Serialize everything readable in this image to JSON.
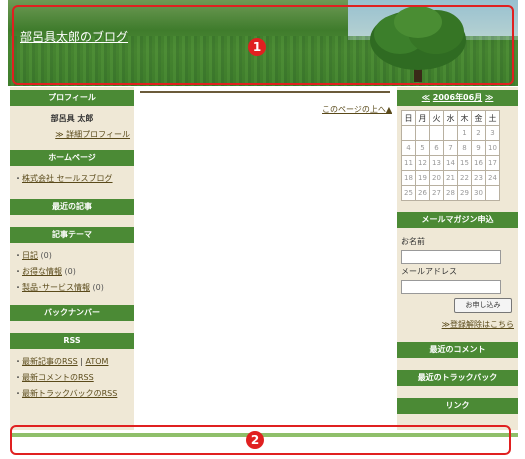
{
  "header": {
    "blog_title": "部呂具太郎のブログ"
  },
  "annotations": [
    "1",
    "2"
  ],
  "left": {
    "profile": {
      "heading": "プロフィール",
      "name": "部呂具 太郎",
      "detail_link": "≫ 詳細プロフィール"
    },
    "homepage": {
      "heading": "ホームページ",
      "link": "株式会社 セールスブログ"
    },
    "recent_posts": {
      "heading": "最近の記事"
    },
    "themes": {
      "heading": "記事テーマ",
      "items": [
        {
          "label": "日記",
          "count": "(0)"
        },
        {
          "label": "お得な情報",
          "count": "(0)"
        },
        {
          "label": "製品･サービス情報",
          "count": "(0)"
        }
      ]
    },
    "backnumber": {
      "heading": "バックナンバー"
    },
    "rss": {
      "heading": "RSS",
      "items": [
        "最新記事のRSS",
        "ATOM",
        "最新コメントのRSS",
        "最新トラックバックのRSS"
      ],
      "separator": "|"
    }
  },
  "center": {
    "page_top_link": "このページの上へ▲"
  },
  "right": {
    "calendar": {
      "prev": "≪",
      "title": "2006年06月",
      "next": "≫",
      "days_of_week": [
        "日",
        "月",
        "火",
        "水",
        "木",
        "金",
        "土"
      ],
      "weeks": [
        [
          "",
          "",
          "",
          "",
          "1",
          "2",
          "3"
        ],
        [
          "4",
          "5",
          "6",
          "7",
          "8",
          "9",
          "10"
        ],
        [
          "11",
          "12",
          "13",
          "14",
          "15",
          "16",
          "17"
        ],
        [
          "18",
          "19",
          "20",
          "21",
          "22",
          "23",
          "24"
        ],
        [
          "25",
          "26",
          "27",
          "28",
          "29",
          "30",
          ""
        ]
      ]
    },
    "magazine": {
      "heading": "メールマガジン申込",
      "name_label": "お名前",
      "email_label": "メールアドレス",
      "submit": "お申し込み",
      "unsubscribe_link": "≫登録解除はこちら"
    },
    "recent_comments": {
      "heading": "最近のコメント"
    },
    "recent_trackbacks": {
      "heading": "最近のトラックバック"
    },
    "links": {
      "heading": "リンク"
    }
  }
}
